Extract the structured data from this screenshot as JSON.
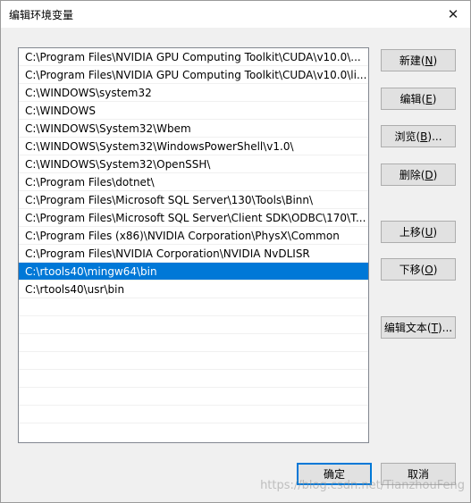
{
  "window": {
    "title": "编辑环境变量",
    "close_glyph": "✕"
  },
  "paths": [
    "C:\\Program Files\\NVIDIA GPU Computing Toolkit\\CUDA\\v10.0\\...",
    "C:\\Program Files\\NVIDIA GPU Computing Toolkit\\CUDA\\v10.0\\li...",
    "C:\\WINDOWS\\system32",
    "C:\\WINDOWS",
    "C:\\WINDOWS\\System32\\Wbem",
    "C:\\WINDOWS\\System32\\WindowsPowerShell\\v1.0\\",
    "C:\\WINDOWS\\System32\\OpenSSH\\",
    "C:\\Program Files\\dotnet\\",
    "C:\\Program Files\\Microsoft SQL Server\\130\\Tools\\Binn\\",
    "C:\\Program Files\\Microsoft SQL Server\\Client SDK\\ODBC\\170\\T...",
    "C:\\Program Files (x86)\\NVIDIA Corporation\\PhysX\\Common",
    "C:\\Program Files\\NVIDIA Corporation\\NVIDIA NvDLISR",
    "C:\\rtools40\\mingw64\\bin",
    "C:\\rtools40\\usr\\bin",
    "",
    "",
    "",
    "",
    "",
    "",
    ""
  ],
  "selected_index": 12,
  "buttons": {
    "new": {
      "label": "新建(",
      "key": "N",
      "tail": ")"
    },
    "edit": {
      "label": "编辑(",
      "key": "E",
      "tail": ")"
    },
    "browse": {
      "label": "浏览(",
      "key": "B",
      "tail": ")..."
    },
    "delete": {
      "label": "删除(",
      "key": "D",
      "tail": ")"
    },
    "move_up": {
      "label": "上移(",
      "key": "U",
      "tail": ")"
    },
    "move_down": {
      "label": "下移(",
      "key": "O",
      "tail": ")"
    },
    "edit_text": {
      "label": "编辑文本(",
      "key": "T",
      "tail": ")..."
    },
    "ok": {
      "label": "确定"
    },
    "cancel": {
      "label": "取消"
    }
  },
  "watermark": "https://blog.csdn.net/TianzhouFeng",
  "colors": {
    "selection": "#0078d7",
    "primary_border": "#0078d7"
  }
}
